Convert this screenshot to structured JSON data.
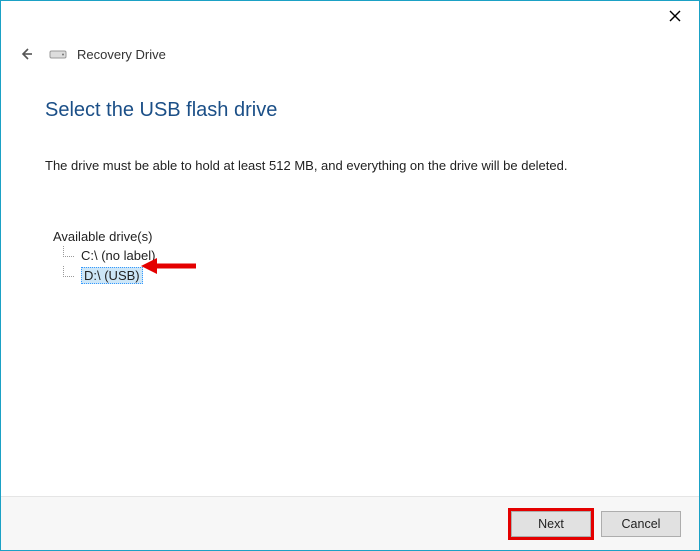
{
  "window": {
    "title": "Recovery Drive"
  },
  "page": {
    "title": "Select the USB flash drive",
    "instruction": "The drive must be able to hold at least 512 MB, and everything on the drive will be deleted."
  },
  "drives": {
    "label": "Available drive(s)",
    "items": [
      {
        "label": "C:\\ (no label)",
        "selected": false
      },
      {
        "label": "D:\\ (USB)",
        "selected": true
      }
    ]
  },
  "footer": {
    "next": "Next",
    "cancel": "Cancel"
  }
}
